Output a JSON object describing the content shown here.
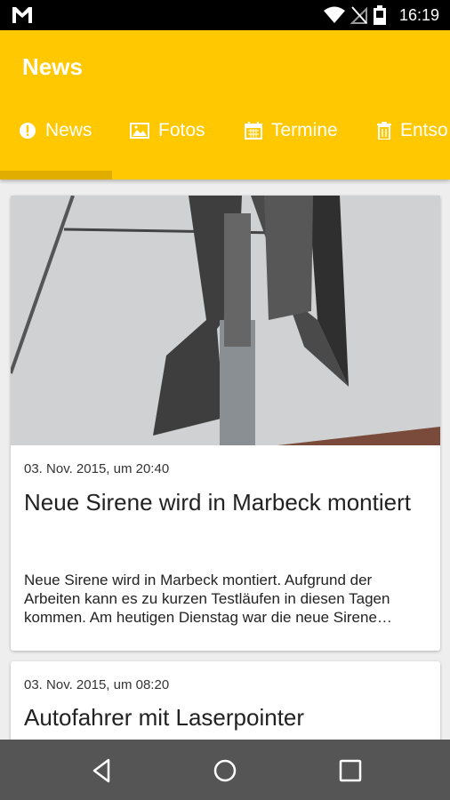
{
  "status_bar": {
    "time": "16:19",
    "icons": [
      "gmail-icon",
      "wifi-icon",
      "no-signal-icon",
      "battery-icon"
    ]
  },
  "app_bar": {
    "title": "News",
    "accent_color": "#ffc800"
  },
  "tabs": [
    {
      "label": "News",
      "icon": "alert-circle-icon",
      "selected": true
    },
    {
      "label": "Fotos",
      "icon": "image-icon",
      "selected": false
    },
    {
      "label": "Termine",
      "icon": "calendar-icon",
      "selected": false
    },
    {
      "label": "Entso",
      "icon": "trash-icon",
      "selected": false
    }
  ],
  "articles": [
    {
      "date": "03. Nov. 2015, um 20:40",
      "title": "Neue Sirene wird in Marbeck montiert",
      "excerpt": "Neue Sirene wird in Marbeck montiert. Aufgrund der Arbeiten kann es zu kurzen Testläufen in diesen Tagen kommen. Am heutigen Dienstag war die neue Sirene…",
      "has_image": true
    },
    {
      "date": "03. Nov. 2015, um 08:20",
      "title": "Autofahrer mit Laserpointer",
      "has_image": false
    }
  ],
  "nav_bar": {
    "buttons": [
      "back-icon",
      "home-icon",
      "recents-icon"
    ]
  }
}
